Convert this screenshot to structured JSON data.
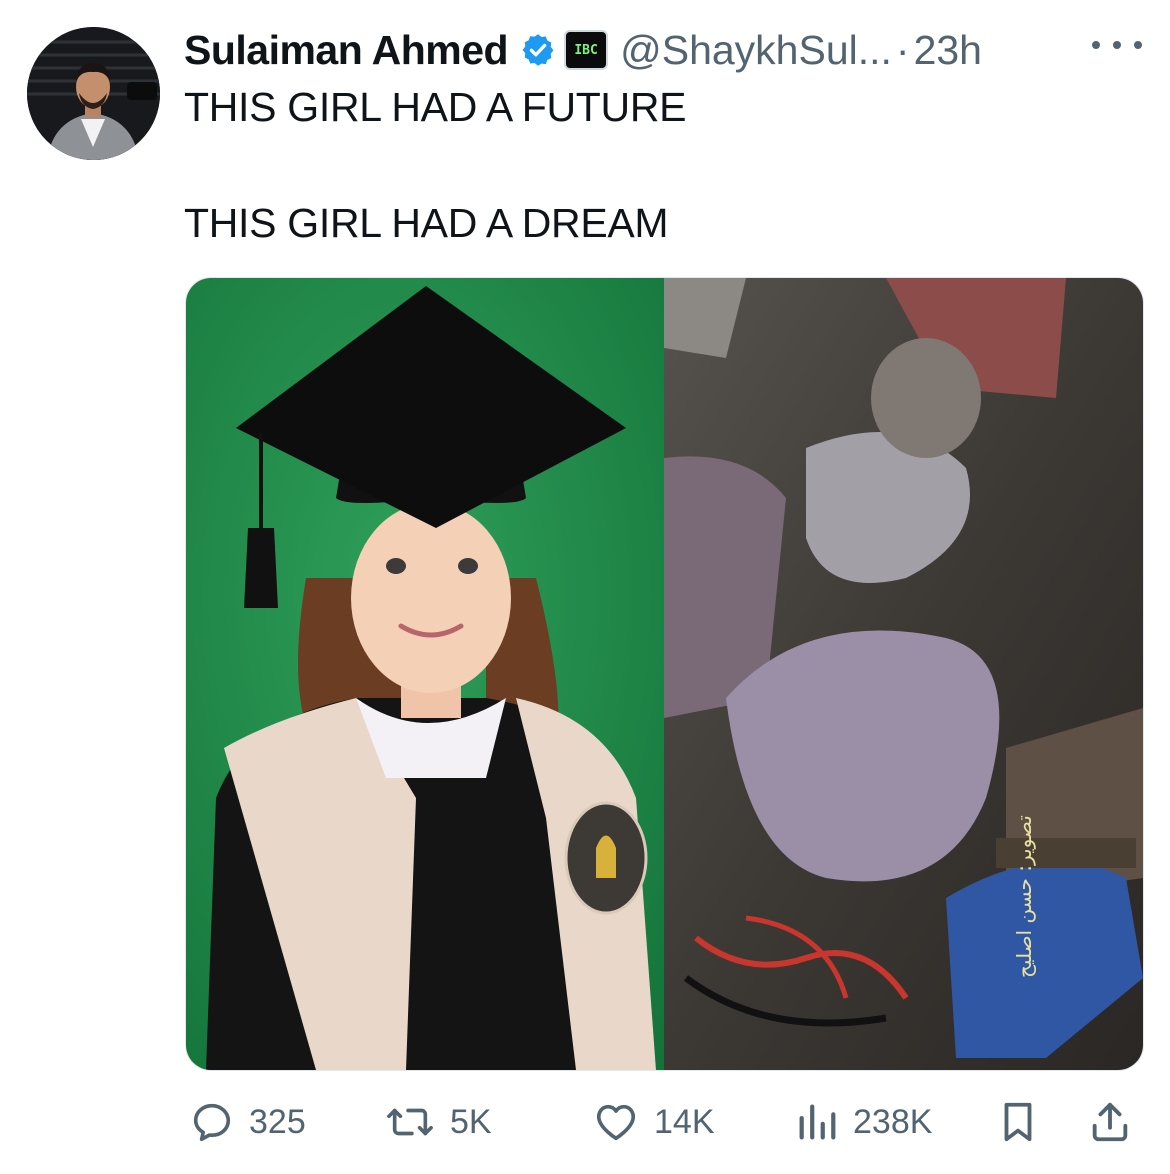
{
  "author": {
    "name": "Sulaiman Ahmed",
    "handle": "@ShaykhSul...",
    "separator": "·",
    "time": "23h",
    "affiliate_badge_text": "IBC",
    "verified_icon": "verified-check-icon"
  },
  "tweet": {
    "line1": "THIS GIRL HAD A FUTURE",
    "line2": "THIS GIRL HAD A DREAM"
  },
  "media": {
    "image_watermark": "تصوير: حسن اصليح"
  },
  "actions": {
    "replies": "325",
    "retweets": "5K",
    "likes": "14K",
    "views": "238K"
  },
  "colors": {
    "text": "#0f1419",
    "secondary": "#536471",
    "verified": "#1d9bf0"
  }
}
